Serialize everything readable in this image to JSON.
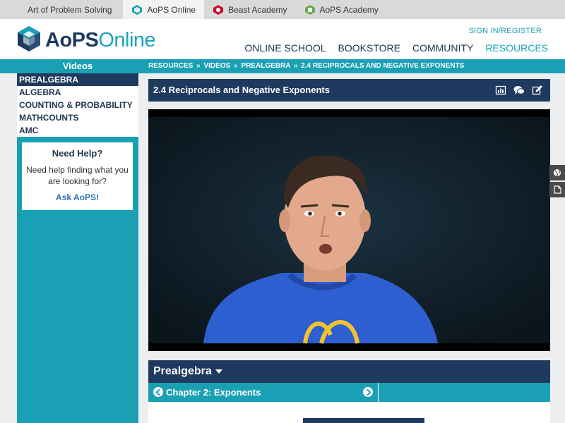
{
  "network_bar": {
    "sites": [
      {
        "label": "Art of Problem Solving",
        "icon": "none"
      },
      {
        "label": "AoPS Online",
        "icon": "aops-online-icon"
      },
      {
        "label": "Beast Academy",
        "icon": "beast-academy-icon"
      },
      {
        "label": "AoPS Academy",
        "icon": "aops-academy-icon"
      }
    ]
  },
  "header": {
    "logo_aops": "AoPS",
    "logo_online": "Online",
    "signin": "SIGN IN/REGISTER",
    "nav": [
      "ONLINE SCHOOL",
      "BOOKSTORE",
      "COMMUNITY",
      "RESOURCES"
    ]
  },
  "sidebar": {
    "heading": "Videos",
    "items": [
      "PREALGEBRA",
      "ALGEBRA",
      "COUNTING & PROBABILITY",
      "MATHCOUNTS",
      "AMC"
    ],
    "help": {
      "title": "Need Help?",
      "text": "Need help finding what you are looking for?",
      "link": "Ask AoPS!"
    }
  },
  "breadcrumb": {
    "items": [
      "RESOURCES",
      "VIDEOS",
      "PREALGEBRA",
      "2.4 RECIPROCALS AND NEGATIVE EXPONENTS"
    ],
    "separator": "»"
  },
  "video": {
    "title": "2.4 Reciprocals and Negative Exponents",
    "icons": [
      "stats-icon",
      "comments-icon",
      "edit-icon"
    ]
  },
  "section": {
    "title": "Prealgebra",
    "chapter": "Chapter 2: Exponents"
  },
  "colors": {
    "navy": "#1f3a5f",
    "teal": "#1aa0b4"
  }
}
